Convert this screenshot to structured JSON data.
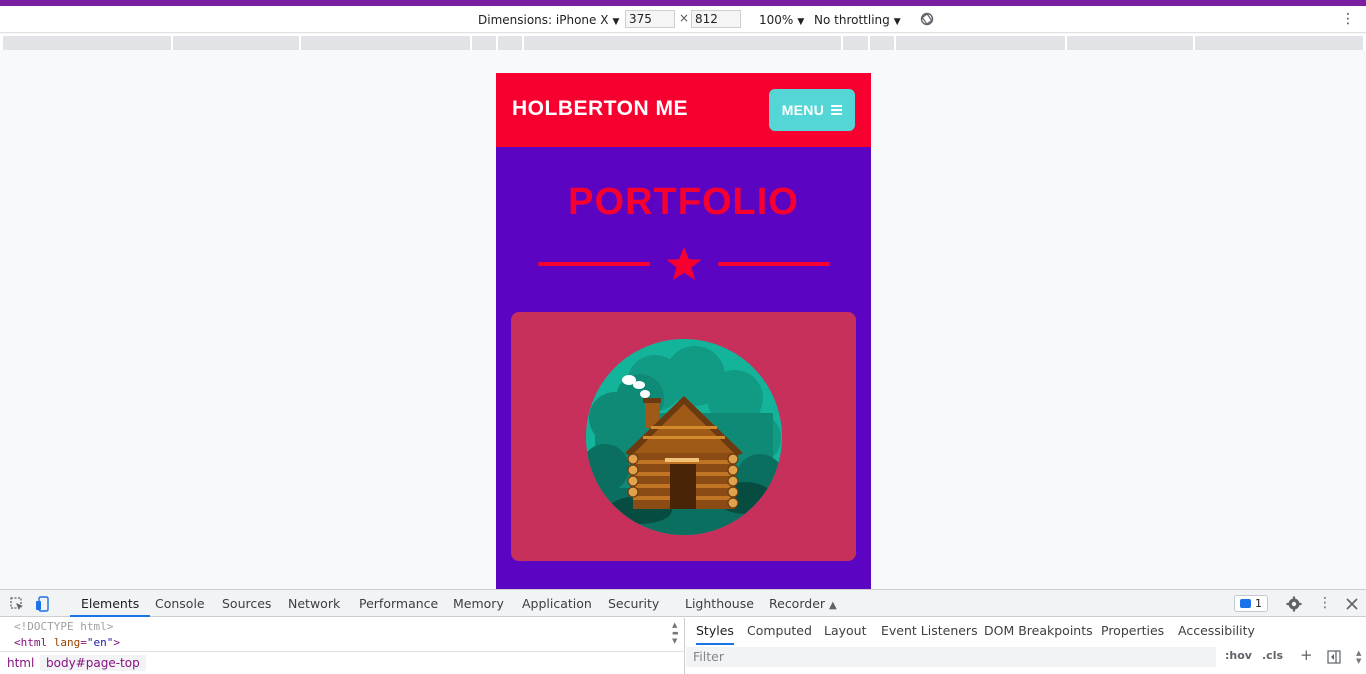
{
  "device_toolbar": {
    "dimensions_label": "Dimensions: iPhone X",
    "width": "375",
    "height": "812",
    "times": "×",
    "zoom": "100%",
    "throttling": "No throttling",
    "more_icon": "⋮"
  },
  "site": {
    "brand": "HOLBERTON ME",
    "menu_label": "MENU",
    "section_title": "PORTFOLIO",
    "colors": {
      "nav": "#f7002f",
      "background": "#5b05c2",
      "menu_button": "#55d6d6",
      "card": "#c7305b"
    },
    "icons": [
      "bars-icon",
      "star-icon",
      "cabin-illustration"
    ]
  },
  "devtools": {
    "tabs": [
      "Elements",
      "Console",
      "Sources",
      "Network",
      "Performance",
      "Memory",
      "Application",
      "Security",
      "Lighthouse",
      "Recorder"
    ],
    "active_tab": "Elements",
    "issues_count": "1",
    "code_lines": {
      "doctype": "<!DOCTYPE html>",
      "html_tag": "<html",
      "lang_attr": "lang",
      "lang_val": "\"en\"",
      "html_close": ">"
    },
    "breadcrumbs": {
      "html": "html",
      "body": "body#page-top"
    },
    "styles_tabs": [
      "Styles",
      "Computed",
      "Layout",
      "Event Listeners",
      "DOM Breakpoints",
      "Properties",
      "Accessibility"
    ],
    "filter_placeholder": "Filter",
    "hov": ":hov",
    "cls": ".cls",
    "plus": "+"
  }
}
